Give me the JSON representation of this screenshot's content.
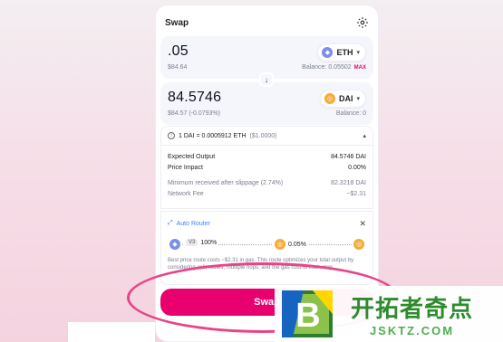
{
  "header": {
    "title": "Swap",
    "settings_icon": "gear-icon"
  },
  "input_panel": {
    "amount": ".05",
    "usd_value": "$84.64",
    "token": "ETH",
    "balance": "Balance: 0.05502",
    "max_label": "MAX"
  },
  "output_panel": {
    "amount": "84.5746",
    "usd_value": "$84.57 (-0.0793%)",
    "token": "DAI",
    "balance": "Balance: 0"
  },
  "rate": {
    "text": "1 DAI = 0.0005912 ETH",
    "usd": "($1.0000)"
  },
  "details": [
    {
      "label": "Expected Output",
      "value": "84.5746 DAI"
    },
    {
      "label": "Price Impact",
      "value": "0.00%"
    },
    {
      "label": "Minimum received after slippage (2.74%)",
      "value": "82.3218 DAI"
    },
    {
      "label": "Network Fee",
      "value": "~$2.31"
    }
  ],
  "router": {
    "title": "Auto Router",
    "pool_version": "V3",
    "route_percent": "100%",
    "fee_tier": "0.05%",
    "description": "Best price route costs ~$2.31 in gas. This route optimizes your total output by considering split routes, multiple hops, and the gas cost of each step."
  },
  "swap_button": {
    "label": "Swap"
  },
  "watermark": {
    "logo_letter": "B",
    "cn": "开拓者奇点",
    "en": "JSKTZ.COM"
  },
  "colors": {
    "accent": "#e8006f",
    "router_blue": "#3b82f6",
    "eth": "#7b8ee8",
    "dai": "#f5ac37"
  }
}
